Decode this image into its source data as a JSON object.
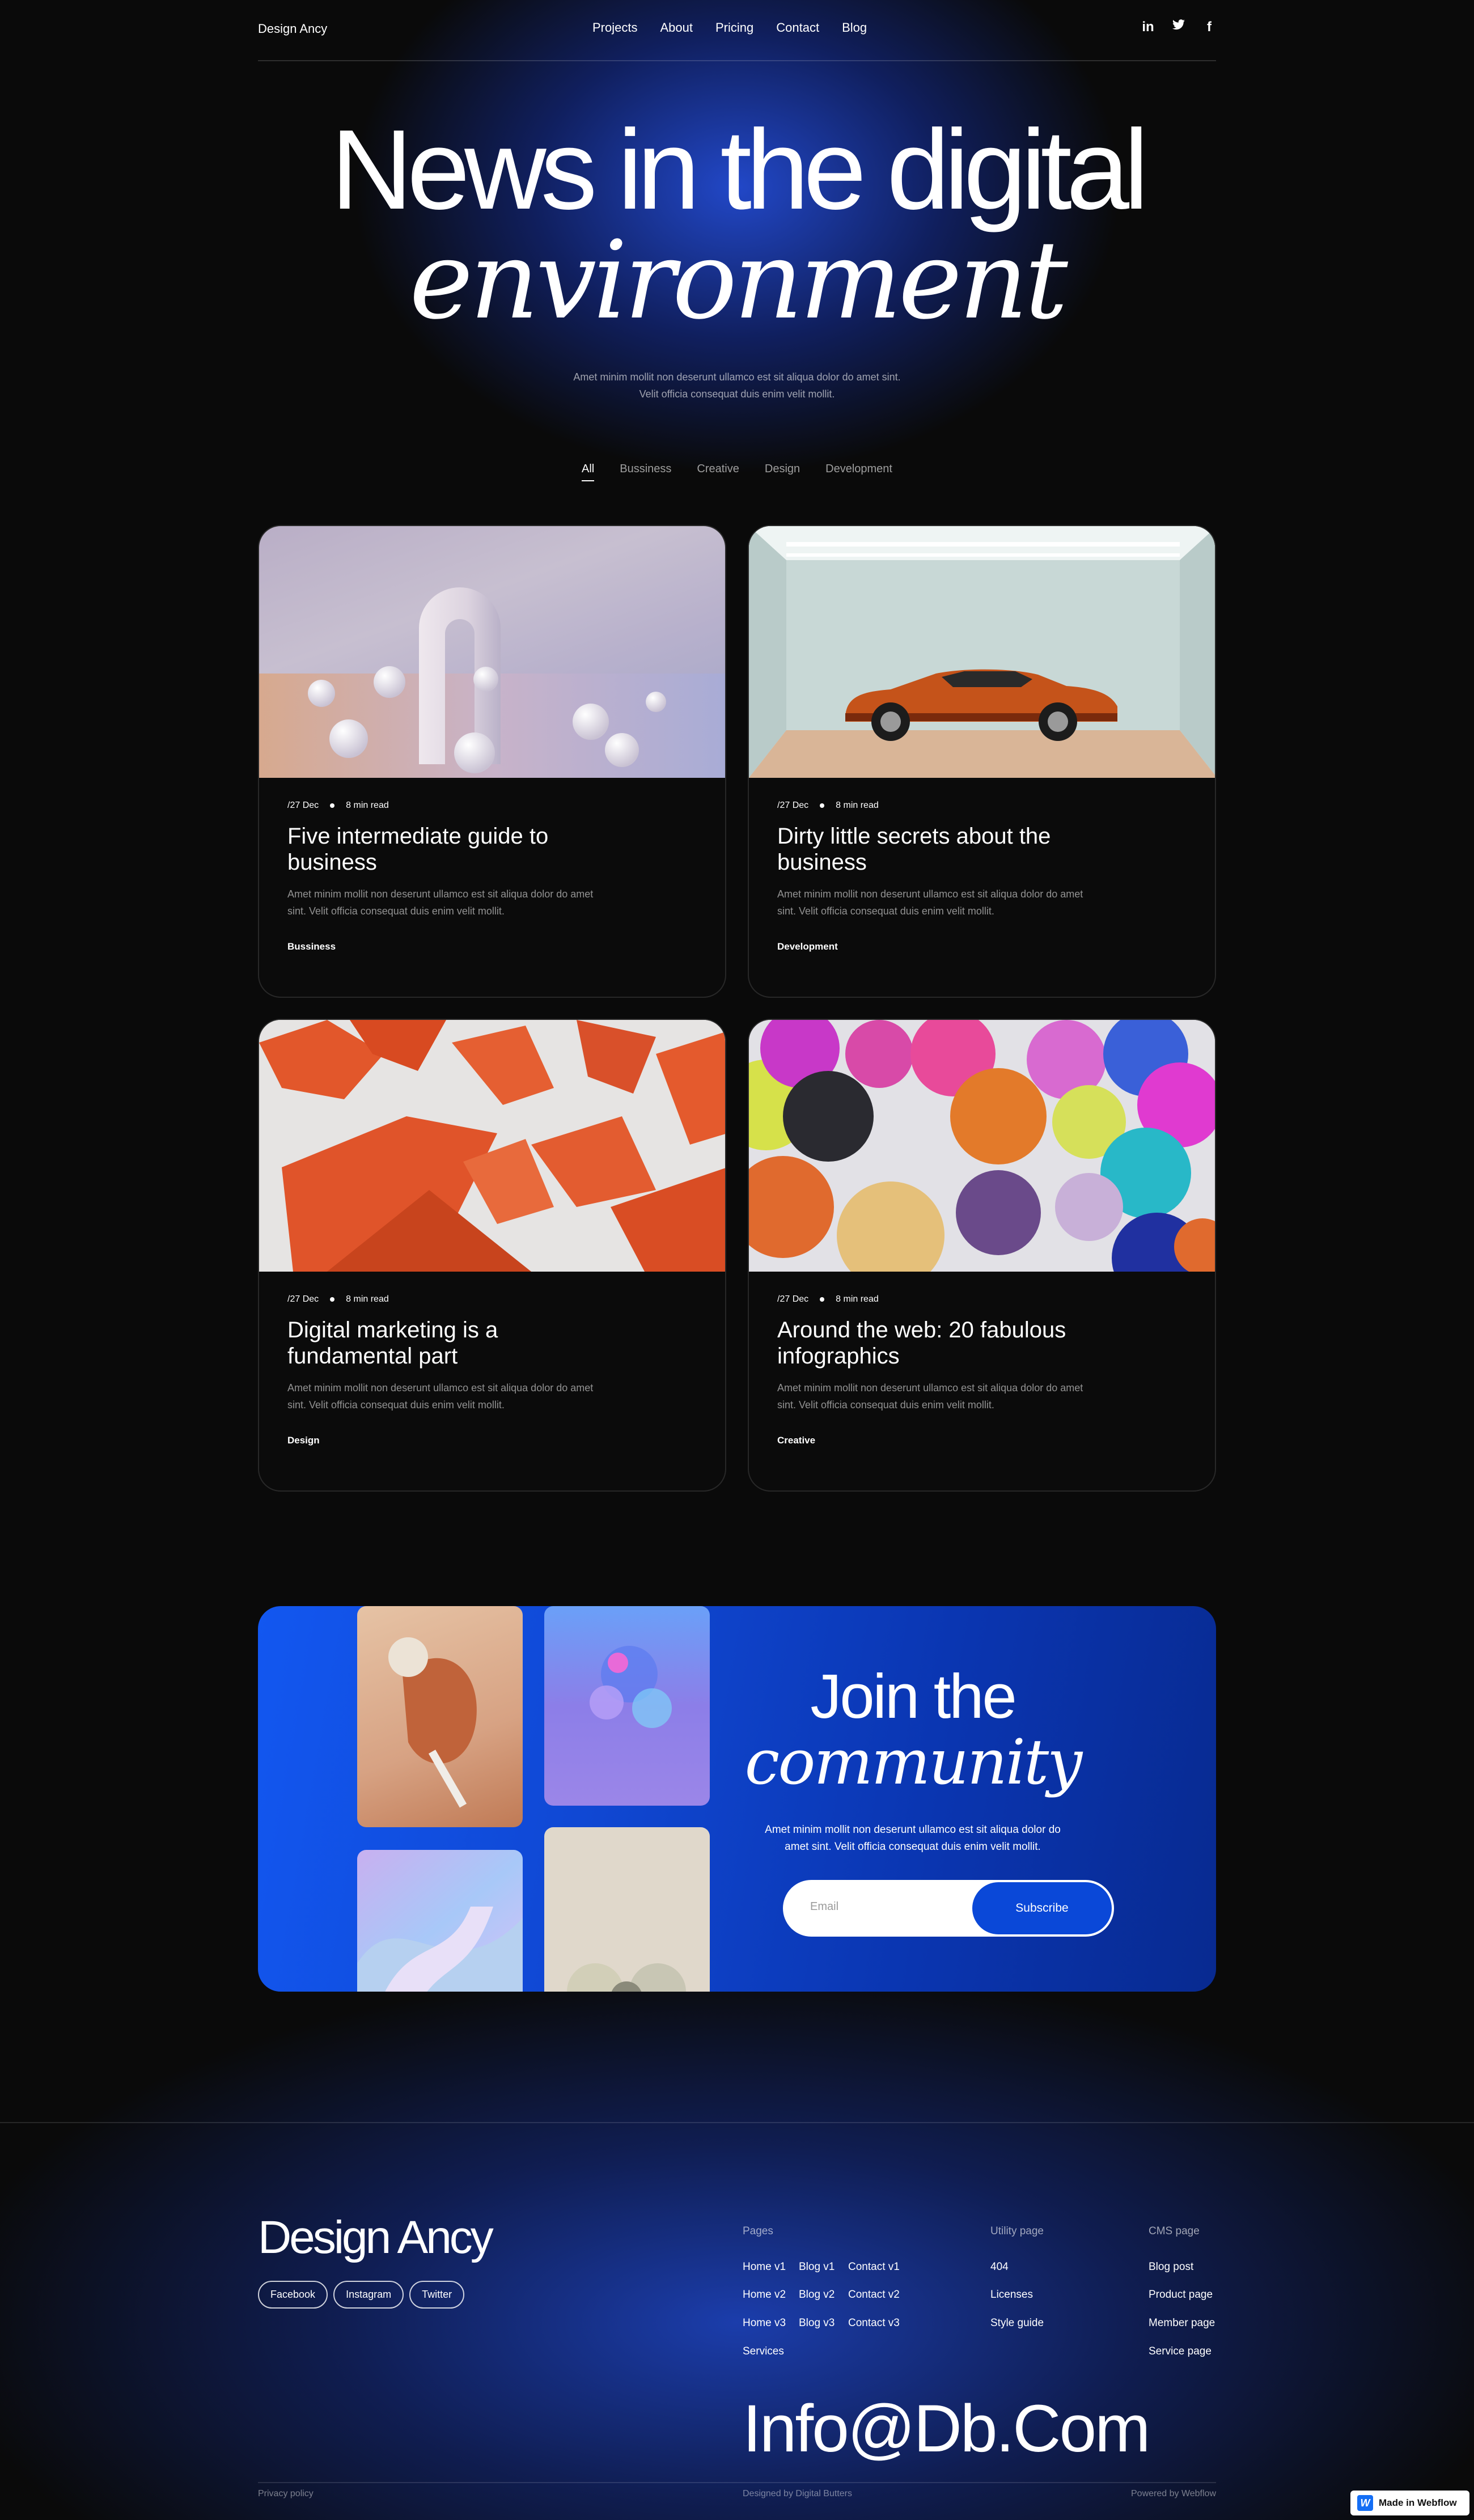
{
  "brand": "Design Ancy",
  "nav": [
    "Projects",
    "About",
    "Pricing",
    "Contact",
    "Blog"
  ],
  "socials": {
    "linkedin": "in",
    "twitter": "𝕥",
    "facebook": "f"
  },
  "hero": {
    "title_line1": "News in the digital",
    "title_line2": "environment",
    "subtitle": "Amet minim mollit non deserunt ullamco est sit aliqua dolor do amet sint. Velit officia consequat duis enim velit mollit."
  },
  "filters": [
    "All",
    "Bussiness",
    "Creative",
    "Design",
    "Development"
  ],
  "cards": [
    {
      "date": "/27 Dec",
      "read": "8 min read",
      "title": "Five intermediate guide to business",
      "desc": "Amet minim mollit non deserunt ullamco est sit aliqua dolor do amet sint. Velit officia consequat duis enim velit mollit.",
      "tag": "Bussiness"
    },
    {
      "date": "/27 Dec",
      "read": "8 min read",
      "title": "Dirty little secrets about the business",
      "desc": "Amet minim mollit non deserunt ullamco est sit aliqua dolor do amet sint. Velit officia consequat duis enim velit mollit.",
      "tag": "Development"
    },
    {
      "date": "/27 Dec",
      "read": "8 min read",
      "title": "Digital marketing is a fundamental part",
      "desc": "Amet minim mollit non deserunt ullamco est sit aliqua dolor do amet sint. Velit officia consequat duis enim velit mollit.",
      "tag": "Design"
    },
    {
      "date": "/27 Dec",
      "read": "8 min read",
      "title": "Around the web: 20 fabulous infographics",
      "desc": "Amet minim mollit non deserunt ullamco est sit aliqua dolor do amet sint. Velit officia consequat duis enim velit mollit.",
      "tag": "Creative"
    }
  ],
  "community": {
    "title_line1": "Join the",
    "title_line2": "community",
    "subtitle": "Amet minim mollit non deserunt ullamco est sit aliqua dolor do amet sint. Velit officia consequat duis enim velit mollit.",
    "email_placeholder": "Email",
    "button": "Subscribe"
  },
  "footer": {
    "brand": "Design Ancy",
    "social_pills": [
      "Facebook",
      "Instagram",
      "Twitter"
    ],
    "pages_heading": "Pages",
    "pages_col1": [
      "Home v1",
      "Home v2",
      "Home v3",
      "Services"
    ],
    "pages_col2": [
      "Blog v1",
      "Blog v2",
      "Blog v3"
    ],
    "pages_col3": [
      "Contact v1",
      "Contact v2",
      "Contact v3"
    ],
    "utility_heading": "Utility page",
    "utility_links": [
      "404",
      "Licenses",
      "Style guide"
    ],
    "cms_heading": "CMS page",
    "cms_links": [
      "Blog post",
      "Product page",
      "Member page",
      "Service page"
    ],
    "email_big": "Info@Db.Com",
    "privacy": "Privacy policy",
    "designed_by": "Designed by Digital Butters",
    "powered_by": "Powered by Webflow",
    "badge": "Made in Webflow"
  }
}
